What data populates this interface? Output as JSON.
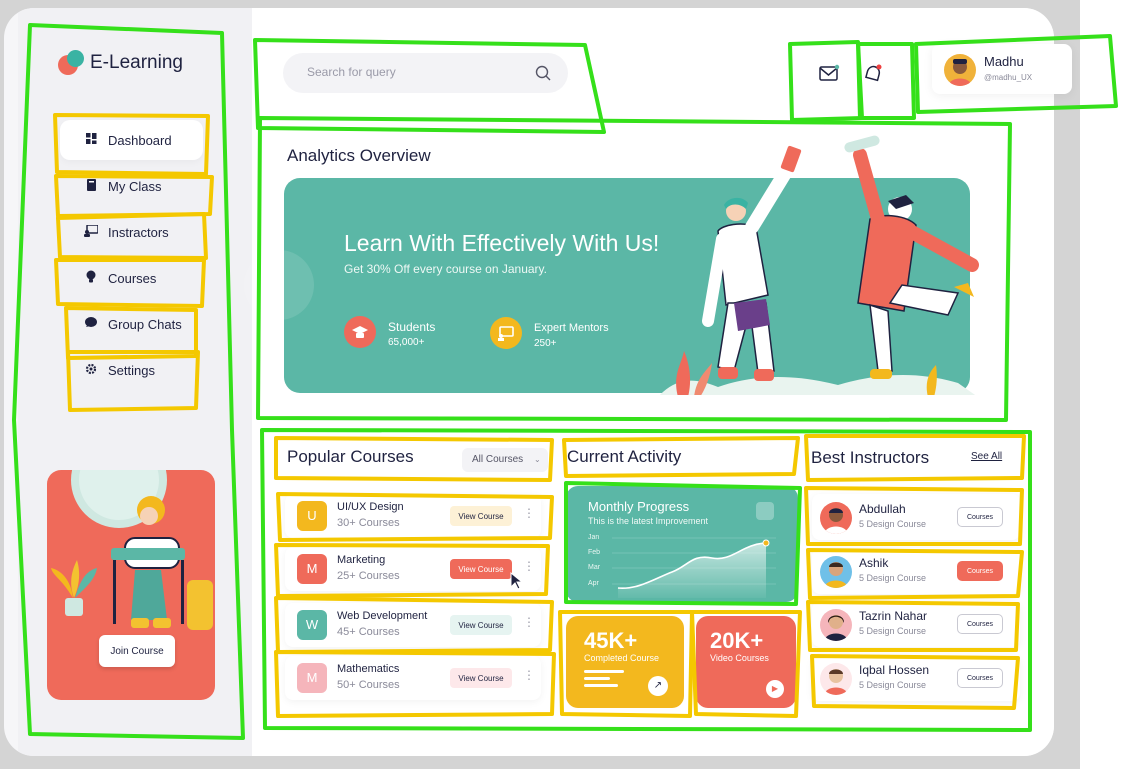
{
  "app": {
    "brand": "E-Learning"
  },
  "sidebar": {
    "items": [
      {
        "label": "Dashboard",
        "icon": "grid-icon",
        "active": true
      },
      {
        "label": "My Class",
        "icon": "book-icon",
        "active": false
      },
      {
        "label": "Instractors",
        "icon": "presentation-icon",
        "active": false
      },
      {
        "label": "Courses",
        "icon": "bulb-icon",
        "active": false
      },
      {
        "label": "Group Chats",
        "icon": "chat-icon",
        "active": false
      },
      {
        "label": "Settings",
        "icon": "gear-icon",
        "active": false
      }
    ],
    "promo": {
      "button_label": "Join Course"
    }
  },
  "header": {
    "search": {
      "placeholder": "Search for query"
    },
    "user": {
      "name": "Madhu",
      "username": "@madhu_UX"
    }
  },
  "analytics": {
    "title": "Analytics Overview",
    "banner": {
      "title": "Learn With Effectively With Us!",
      "subtitle": "Get 30% Off every course on January.",
      "stats": [
        {
          "label": "Students",
          "value": "65,000+",
          "icon": "graduation-cap-icon",
          "color": "#ef6a5a"
        },
        {
          "label": "Expert Mentors",
          "value": "250+",
          "icon": "board-icon",
          "color": "#f3b81e"
        }
      ]
    }
  },
  "popular_courses": {
    "title": "Popular Courses",
    "filter_value": "All Courses",
    "items": [
      {
        "letter": "U",
        "name": "UI/UX Design",
        "count": "30+ Courses",
        "button": "View Course",
        "badge_color": "#f3b81e",
        "button_style": "light-yellow"
      },
      {
        "letter": "M",
        "name": "Marketing",
        "count": "25+ Courses",
        "button": "View Course",
        "badge_color": "#ef6a5a",
        "button_style": "red"
      },
      {
        "letter": "W",
        "name": "Web Development",
        "count": "45+ Courses",
        "button": "View Course",
        "badge_color": "#5bb7a6",
        "button_style": "light-teal"
      },
      {
        "letter": "M",
        "name": "Mathematics",
        "count": "50+ Courses",
        "button": "View Course",
        "badge_color": "#f5b5bb",
        "button_style": "light-pink"
      }
    ]
  },
  "current_activity": {
    "title": "Current Activity",
    "progress": {
      "title": "Monthly Progress",
      "subtitle": "This is the latest Improvement",
      "months": [
        "Jan",
        "Feb",
        "Mar",
        "Apr"
      ]
    },
    "stats": [
      {
        "value": "45K+",
        "label": "Completed Course",
        "color": "#f3b81e"
      },
      {
        "value": "20K+",
        "label": "Video Courses",
        "color": "#ef6a5a"
      }
    ]
  },
  "best_instructors": {
    "title": "Best Instructors",
    "see_all": "See All",
    "items": [
      {
        "name": "Abdullah",
        "courses": "5 Design Course",
        "button": "Courses",
        "highlight": false
      },
      {
        "name": "Ashik",
        "courses": "5 Design Course",
        "button": "Courses",
        "highlight": true
      },
      {
        "name": "Tazrin Nahar",
        "courses": "5 Design Course",
        "button": "Courses",
        "highlight": false
      },
      {
        "name": "Iqbal Hossen",
        "courses": "5 Design Course",
        "button": "Courses",
        "highlight": false
      }
    ]
  }
}
